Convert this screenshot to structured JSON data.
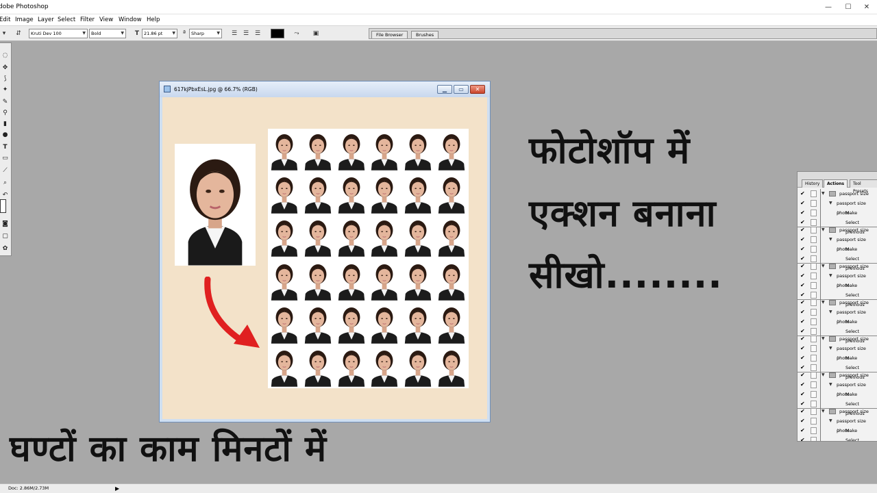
{
  "app": {
    "title": "dobe Photoshop"
  },
  "menu": [
    "Edit",
    "Image",
    "Layer",
    "Select",
    "Filter",
    "View",
    "Window",
    "Help"
  ],
  "options": {
    "font_family": "Kruti Dev 100",
    "font_style": "Bold",
    "font_size": "21.86 pt",
    "anti_alias": "Sharp",
    "text_color": "#000000"
  },
  "palette_well": [
    "File Browser",
    "Brushes"
  ],
  "document": {
    "title": "617kjPbxEsL.jpg @ 66.7% (RGB)",
    "grid_rows": 6,
    "grid_cols": 6
  },
  "headline": {
    "line1": "फोटोशॉप में",
    "line2": "एक्शन बनाना",
    "line3": "सीखो........",
    "bottom": "घण्टों का काम मिनटों में"
  },
  "actions_panel": {
    "tabs": [
      "History",
      "Actions",
      "Tool Presets"
    ],
    "groups": [
      {
        "set": "passport size",
        "action": "passport size photo",
        "step": "Make",
        "step2": "Select previous"
      },
      {
        "set": "passport size",
        "action": "passport size photo",
        "step": "Make",
        "step2": "Select previous"
      },
      {
        "set": "passport size",
        "action": "passport size photo",
        "step": "Make",
        "step2": "Select previous"
      },
      {
        "set": "passport size",
        "action": "passport size photo",
        "step": "Make",
        "step2": "Select previous"
      },
      {
        "set": "passport size",
        "action": "passport size photo",
        "step": "Make",
        "step2": "Select previous"
      },
      {
        "set": "passport size",
        "action": "passport size photo",
        "step": "Make",
        "step2": "Select previous"
      },
      {
        "set": "passport size",
        "action": "passport size photo",
        "step": "Make",
        "step2": "Select previous"
      }
    ]
  },
  "status": {
    "doc": "Doc: 2.86M/2.73M"
  },
  "colors": {
    "workspace": "#a8a8a8",
    "canvas": "#f3e2c9",
    "arrow": "#e02020"
  }
}
